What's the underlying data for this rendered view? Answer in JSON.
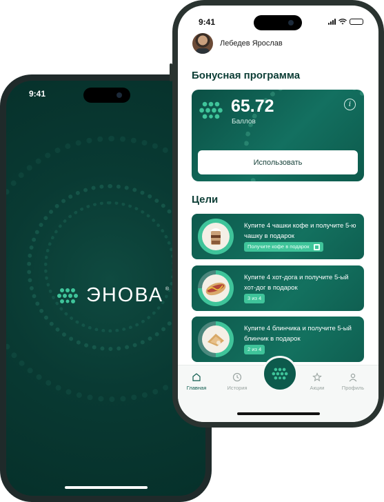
{
  "splash_phone": {
    "status_time": "9:41",
    "brand_name": "ЭНОВА",
    "brand_mark": "®",
    "colors": {
      "background": "#093a33",
      "accent": "#3fc49a"
    }
  },
  "app_phone": {
    "status_time": "9:41",
    "profile": {
      "name": "Лебедев Ярослав"
    },
    "bonus": {
      "section_title": "Бонусная программа",
      "points": "65.72",
      "points_unit": "Баллов",
      "use_button": "Использовать"
    },
    "goals": {
      "section_title": "Цели",
      "items": [
        {
          "text": "Купите 4 чашки кофе и получите 5-ю чашку в подарок",
          "badge": "Получите кофе в подарок",
          "progress": 1.0,
          "icon": "coffee-cup-image"
        },
        {
          "text": "Купите 4 хот-дога и получите 5-ый хот-дог в подарок",
          "badge": "3 из 4",
          "progress": 0.75,
          "icon": "hot-dog-image"
        },
        {
          "text": "Купите 4 блинчика и получите 5-ый блинчик в подарок",
          "badge": "2 из 4",
          "progress": 0.5,
          "icon": "pancake-image"
        }
      ]
    },
    "tabs": [
      {
        "label": "Главная",
        "icon": "home-icon",
        "active": true
      },
      {
        "label": "История",
        "icon": "history-icon",
        "active": false
      },
      {
        "label": "Акции",
        "icon": "star-icon",
        "active": false
      },
      {
        "label": "Профиль",
        "icon": "profile-icon",
        "active": false
      }
    ],
    "colors": {
      "primary": "#0d5a4c",
      "accent": "#3fc49a",
      "title": "#0c3d35"
    }
  }
}
